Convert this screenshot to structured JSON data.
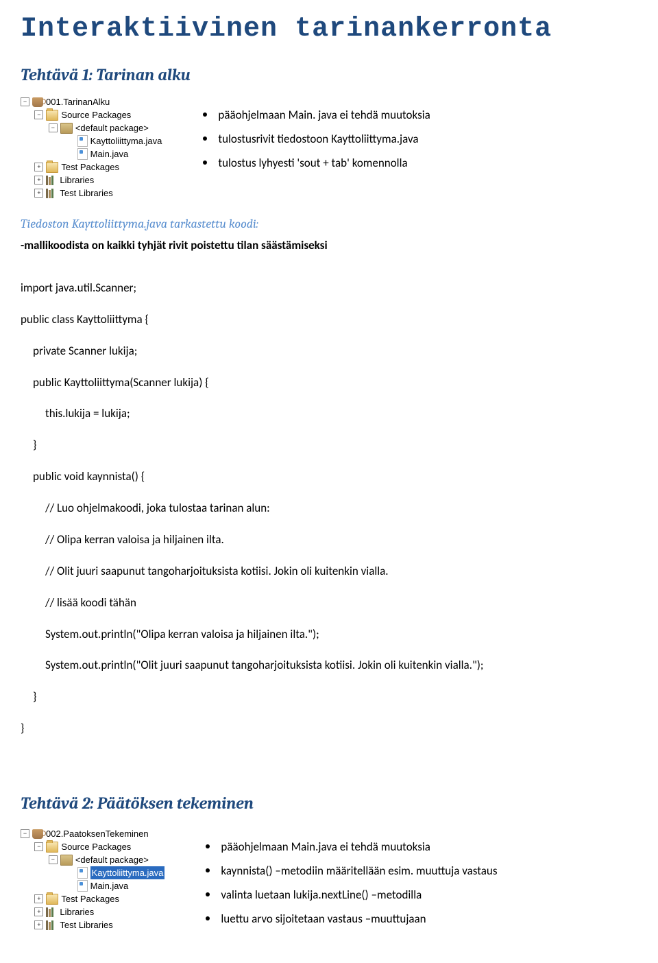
{
  "title": "Interaktiivinen tarinankerronta",
  "section1": {
    "heading": "Tehtävä 1: Tarinan alku",
    "tree": {
      "root": "001.TarinanAlku",
      "sourcePackages": "Source Packages",
      "defaultPkg": "<default package>",
      "file1": "Kayttoliittyma.java",
      "file2": "Main.java",
      "testPackages": "Test Packages",
      "libraries": "Libraries",
      "testLibraries": "Test Libraries"
    },
    "bullets": {
      "b1": "pääohjelmaan Main. java ei tehdä muutoksia",
      "b2": "tulostusrivit tiedostoon Kayttoliittyma.java",
      "b3": "tulostus lyhyesti  'sout + tab' komennolla"
    },
    "subheading": "Tiedoston Kayttoliittyma.java tarkastettu koodi:",
    "note": "-mallikoodista on kaikki tyhjät rivit poistettu  tilan säästämiseksi",
    "code": {
      "l1": "import java.util.Scanner;",
      "l2": "public class Kayttoliittyma {",
      "l3": "private Scanner lukija;",
      "l4": "public Kayttoliittyma(Scanner lukija) {",
      "l5": "this.lukija = lukija;",
      "l6": "}",
      "l7": "public void kaynnista() {",
      "l8": "// Luo ohjelmakoodi, joka tulostaa tarinan alun:",
      "l9": "// Olipa kerran valoisa ja hiljainen ilta.",
      "l10": "// Olit juuri saapunut tangoharjoituksista kotiisi. Jokin oli kuitenkin vialla.",
      "l11": "// lisää koodi tähän",
      "l12": "System.out.println(\"Olipa kerran valoisa ja hiljainen ilta.\");",
      "l13": "System.out.println(\"Olit juuri saapunut tangoharjoituksista kotiisi. Jokin oli kuitenkin vialla.\");",
      "l14": "}",
      "l15": "}"
    }
  },
  "section2": {
    "heading": "Tehtävä 2: Päätöksen tekeminen",
    "tree": {
      "root": "002.PaatoksenTekeminen",
      "sourcePackages": "Source Packages",
      "defaultPkg": "<default package>",
      "file1": "Kayttoliittyma.java",
      "file2": "Main.java",
      "testPackages": "Test Packages",
      "libraries": "Libraries",
      "testLibraries": "Test Libraries"
    },
    "bullets": {
      "b1": "pääohjelmaan Main.java ei tehdä muutoksia",
      "b2": "kaynnista() –metodiin määritellään esim. muuttuja vastaus",
      "b3": "valinta luetaan lukija.nextLine() –metodilla",
      "b4": "luettu arvo sijoitetaan vastaus –muuttujaan"
    }
  }
}
